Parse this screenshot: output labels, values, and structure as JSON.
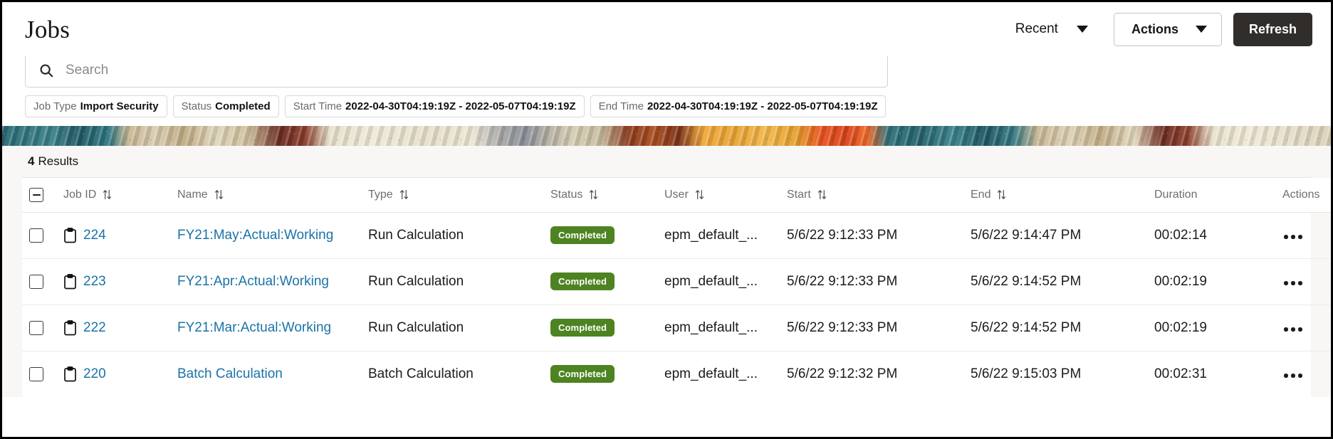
{
  "header": {
    "title": "Jobs",
    "recent_label": "Recent",
    "actions_label": "Actions",
    "refresh_label": "Refresh",
    "caret_icon": "chevron-down-icon"
  },
  "search": {
    "placeholder": "Search",
    "value": "",
    "icon": "search-icon"
  },
  "filters": [
    {
      "label": "Job Type",
      "value": "Import Security"
    },
    {
      "label": "Status",
      "value": "Completed"
    },
    {
      "label": "Start Time",
      "value": "2022-04-30T04:19:19Z - 2022-05-07T04:19:19Z"
    },
    {
      "label": "End Time",
      "value": "2022-04-30T04:19:19Z - 2022-05-07T04:19:19Z"
    }
  ],
  "results": {
    "count": "4",
    "label": "Results"
  },
  "table": {
    "select_all_state": "indeterminate",
    "columns": [
      {
        "key": "jobid",
        "label": "Job ID",
        "sortable": true
      },
      {
        "key": "name",
        "label": "Name",
        "sortable": true
      },
      {
        "key": "type",
        "label": "Type",
        "sortable": true
      },
      {
        "key": "status",
        "label": "Status",
        "sortable": true
      },
      {
        "key": "user",
        "label": "User",
        "sortable": true
      },
      {
        "key": "start",
        "label": "Start",
        "sortable": true
      },
      {
        "key": "end",
        "label": "End",
        "sortable": true
      },
      {
        "key": "duration",
        "label": "Duration",
        "sortable": false
      },
      {
        "key": "actions",
        "label": "Actions",
        "sortable": false
      }
    ],
    "rows": [
      {
        "jobid": "224",
        "name": "FY21:May:Actual:Working",
        "type": "Run Calculation",
        "status": "Completed",
        "user": "epm_default_...",
        "start": "5/6/22 9:12:33 PM",
        "end": "5/6/22 9:14:47 PM",
        "duration": "00:02:14"
      },
      {
        "jobid": "223",
        "name": "FY21:Apr:Actual:Working",
        "type": "Run Calculation",
        "status": "Completed",
        "user": "epm_default_...",
        "start": "5/6/22 9:12:33 PM",
        "end": "5/6/22 9:14:52 PM",
        "duration": "00:02:19"
      },
      {
        "jobid": "222",
        "name": "FY21:Mar:Actual:Working",
        "type": "Run Calculation",
        "status": "Completed",
        "user": "epm_default_...",
        "start": "5/6/22 9:12:33 PM",
        "end": "5/6/22 9:14:52 PM",
        "duration": "00:02:19"
      },
      {
        "jobid": "220",
        "name": "Batch Calculation",
        "type": "Batch Calculation",
        "status": "Completed",
        "user": "epm_default_...",
        "start": "5/6/22 9:12:32 PM",
        "end": "5/6/22 9:15:03 PM",
        "duration": "00:02:31"
      }
    ]
  },
  "colors": {
    "status_completed": "#4d8321",
    "link": "#1a73a7",
    "refresh_button": "#312d2a",
    "results_bar_bg": "#f8f7f6"
  }
}
